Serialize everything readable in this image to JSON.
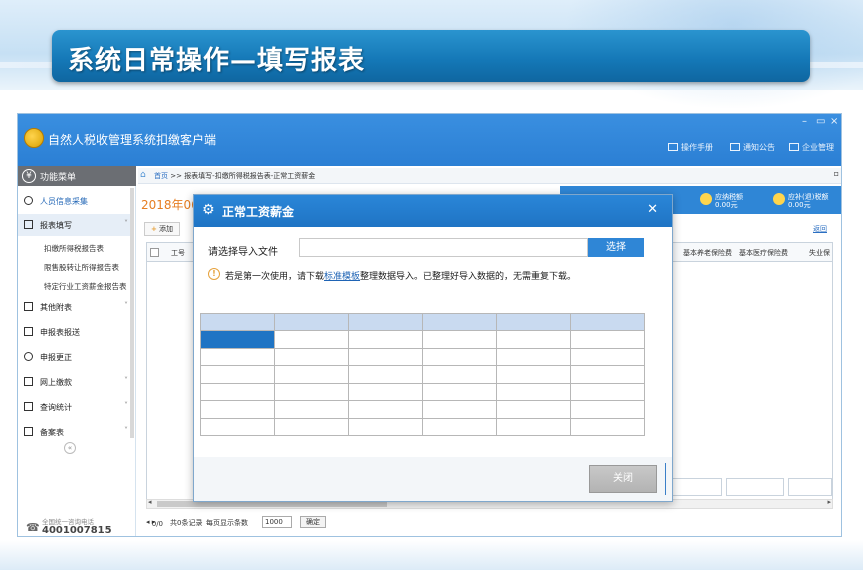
{
  "slide": {
    "title": "系统日常操作—填写报表"
  },
  "app": {
    "title": "自然人税收管理系统扣缴客户端",
    "window_controls": [
      "–",
      "▭",
      "×"
    ],
    "header_links": [
      "操作手册",
      "通知公告",
      "企业管理"
    ]
  },
  "sidebar": {
    "header": "功能菜单",
    "items": [
      {
        "label": "人员信息采集",
        "icon": "person-icon"
      },
      {
        "label": "报表填写",
        "icon": "form-icon",
        "expanded": true
      },
      {
        "label": "其他附表",
        "icon": "table-icon"
      },
      {
        "label": "申报表报送",
        "icon": "submit-icon"
      },
      {
        "label": "申报更正",
        "icon": "magnifier-icon"
      },
      {
        "label": "网上缴款",
        "icon": "payment-icon"
      },
      {
        "label": "查询统计",
        "icon": "stats-icon"
      },
      {
        "label": "备案表",
        "icon": "record-icon"
      }
    ],
    "subitems": [
      "扣缴所得税报告表",
      "限售股转让所得报告表",
      "特定行业工资薪金报告表"
    ],
    "hotline_label": "全国统一咨询电话",
    "hotline_number": "4001007815"
  },
  "main": {
    "breadcrumb_home": "首页",
    "breadcrumb_sep": " >> ",
    "breadcrumb_rest": "报表填写-扣缴所得税报告表-正常工资薪金",
    "year_label": "2018年06",
    "tax_items": [
      {
        "label": "应纳税额",
        "value": "0.00元"
      },
      {
        "label": "应补(退)税额",
        "value": "0.00元"
      }
    ],
    "add_button": "添加",
    "return_link": "返回",
    "grid_headers": [
      "工号",
      "基本养老保险费",
      "基本医疗保险费",
      "失业保"
    ],
    "pager_text": "0/0",
    "pager_records": "共0条记录",
    "pager_per_page": "每页显示条数",
    "pager_size": "1000",
    "pager_ok": "确定"
  },
  "dialog": {
    "title": "正常工资薪金",
    "file_label": "请选择导入文件",
    "file_value": "",
    "choose_button": "选择",
    "warn_prefix": "若是第一次使用，请下载",
    "warn_link": "标准模板",
    "warn_suffix": "整理数据导入。已整理好导入数据的，无需重复下载。",
    "close_button": "关闭"
  },
  "colors": {
    "title_bar": "#1477b6",
    "app_header": "#2b7fd4",
    "dialog_header": "#2a86d8",
    "year_label": "#e67e22",
    "accent_link": "#1f64b5"
  }
}
